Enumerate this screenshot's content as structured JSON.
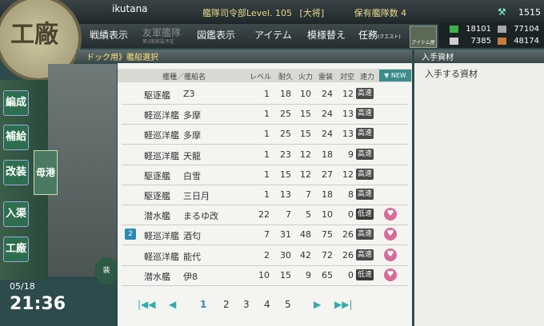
{
  "header": {
    "emblem_text": "工廠",
    "admiral_name": "ikutana",
    "hq_label": "艦隊司令部Level.",
    "hq_level": "105",
    "rank": "[大将]",
    "fleet_count_label": "保有艦隊数",
    "fleet_count": "4",
    "top_resource": "1515"
  },
  "nav": {
    "items": [
      {
        "label": "戦績表示"
      },
      {
        "label": "友軍艦隊",
        "sub": "第2期実装予定"
      },
      {
        "label": "図鑑表示"
      },
      {
        "label": "アイテム"
      },
      {
        "label": "模様替え"
      },
      {
        "label": "任務",
        "sub": "(クエスト)"
      }
    ],
    "item_shop_label": "アイテム屋"
  },
  "resources": {
    "fuel": "18101",
    "ammo": "77104",
    "steel": "7385",
    "bauxite": "48174",
    "colors": {
      "fuel": "#3cb04a",
      "ammo": "#a6a6a6",
      "steel": "#cfcfcf",
      "bauxite": "#c87a3a"
    }
  },
  "subheader": {
    "breadcrumb": "ドック用》艦船選択"
  },
  "side_panel": {
    "title": "入手資材",
    "subtitle": "入手する資材"
  },
  "left_menu": [
    {
      "label": "編成"
    },
    {
      "label": "補給"
    },
    {
      "label": "改装"
    },
    {
      "label": "入渠"
    },
    {
      "label": "工廠"
    }
  ],
  "dock_tab": "母港",
  "equip_button": "装",
  "datetime": {
    "date": "05/18",
    "time": "21:36"
  },
  "table": {
    "headers": [
      "艦種／艦船名",
      "レベル",
      "耐久",
      "火力",
      "雷装",
      "対空",
      "速力"
    ],
    "new_button": "▼ NEW",
    "rows": [
      {
        "type": "駆逐艦",
        "name": "Z3",
        "level": "1",
        "hp": "18",
        "fire": "10",
        "torp": "24",
        "aa": "12",
        "speed": "高速",
        "heart": false,
        "fleet": ""
      },
      {
        "type": "軽巡洋艦",
        "name": "多摩",
        "level": "1",
        "hp": "25",
        "fire": "15",
        "torp": "24",
        "aa": "13",
        "speed": "高速",
        "heart": false,
        "fleet": ""
      },
      {
        "type": "軽巡洋艦",
        "name": "多摩",
        "level": "1",
        "hp": "25",
        "fire": "15",
        "torp": "24",
        "aa": "13",
        "speed": "高速",
        "heart": false,
        "fleet": ""
      },
      {
        "type": "軽巡洋艦",
        "name": "天龍",
        "level": "1",
        "hp": "23",
        "fire": "12",
        "torp": "18",
        "aa": "9",
        "speed": "高速",
        "heart": false,
        "fleet": ""
      },
      {
        "type": "駆逐艦",
        "name": "白雪",
        "level": "1",
        "hp": "15",
        "fire": "12",
        "torp": "27",
        "aa": "12",
        "speed": "高速",
        "heart": false,
        "fleet": ""
      },
      {
        "type": "駆逐艦",
        "name": "三日月",
        "level": "1",
        "hp": "13",
        "fire": "7",
        "torp": "18",
        "aa": "8",
        "speed": "高速",
        "heart": false,
        "fleet": ""
      },
      {
        "type": "潜水艦",
        "name": "まるゆ改",
        "level": "22",
        "hp": "7",
        "fire": "5",
        "torp": "10",
        "aa": "0",
        "speed": "低速",
        "heart": true,
        "fleet": ""
      },
      {
        "type": "軽巡洋艦",
        "name": "酒匂",
        "level": "7",
        "hp": "31",
        "fire": "48",
        "torp": "75",
        "aa": "26",
        "speed": "高速",
        "heart": true,
        "fleet": "2"
      },
      {
        "type": "軽巡洋艦",
        "name": "能代",
        "level": "2",
        "hp": "30",
        "fire": "42",
        "torp": "72",
        "aa": "26",
        "speed": "高速",
        "heart": true,
        "fleet": ""
      },
      {
        "type": "潜水艦",
        "name": "伊8",
        "level": "10",
        "hp": "15",
        "fire": "9",
        "torp": "65",
        "aa": "0",
        "speed": "低速",
        "heart": true,
        "fleet": ""
      }
    ]
  },
  "pagination": {
    "first": "|◀◀",
    "prev": "◀",
    "pages": [
      "1",
      "2",
      "3",
      "4",
      "5"
    ],
    "current": "1",
    "next": "▶",
    "last": "▶▶|"
  }
}
